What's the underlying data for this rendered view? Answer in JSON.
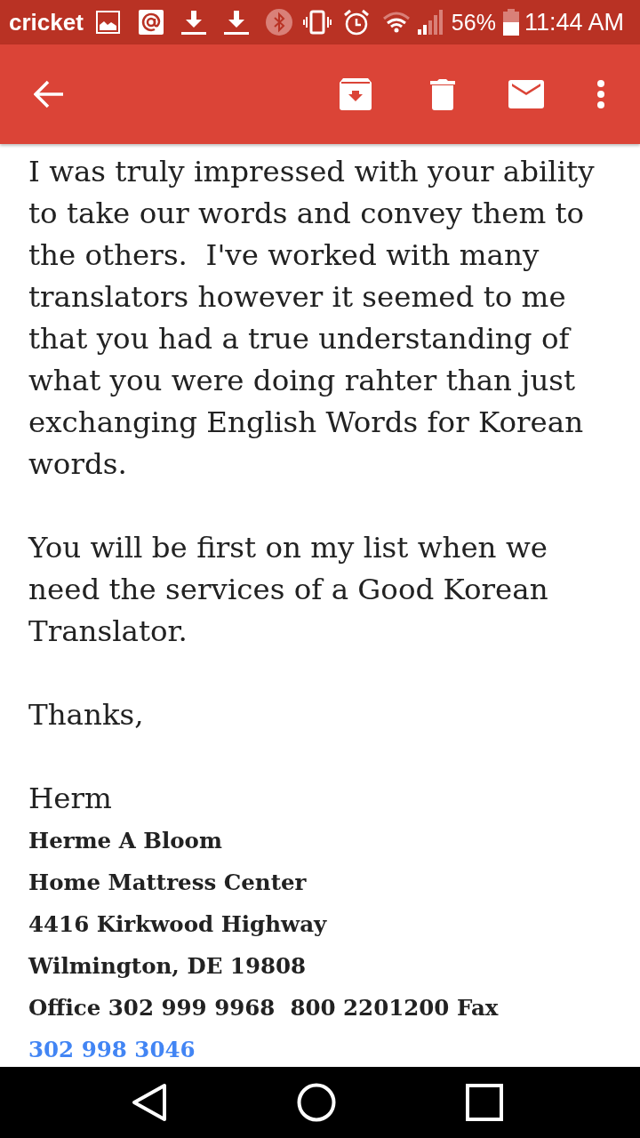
{
  "status_bar": {
    "carrier": "cricket",
    "battery": "56%",
    "time": "11:44 AM"
  },
  "message": {
    "paragraphs": [
      "I was truly impressed with your ability to take our words and convey them to the others.  I've worked with many translators however it seemed to me that you had a true understanding of what you were doing rahter than just exchanging English Words for Korean words.",
      "You will be first on my list when we need the services of a Good Korean Translator.",
      "Thanks,"
    ],
    "sender": "Herm",
    "signature": [
      "Herme A Bloom",
      "Home Mattress Center",
      "4416 Kirkwood Highway",
      "Wilmington, DE 19808"
    ],
    "contact": {
      "text": "Office 302 999 9968  800 2201200 Fax",
      "link": "302 998 3046"
    }
  }
}
